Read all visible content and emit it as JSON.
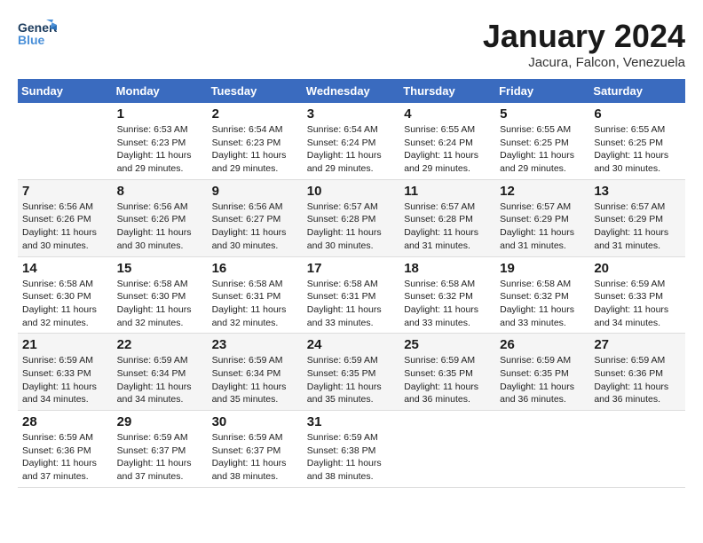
{
  "header": {
    "logo_general": "General",
    "logo_blue": "Blue",
    "month_year": "January 2024",
    "location": "Jacura, Falcon, Venezuela"
  },
  "days_of_week": [
    "Sunday",
    "Monday",
    "Tuesday",
    "Wednesday",
    "Thursday",
    "Friday",
    "Saturday"
  ],
  "weeks": [
    [
      {
        "num": "",
        "sunrise": "",
        "sunset": "",
        "daylight": ""
      },
      {
        "num": "1",
        "sunrise": "Sunrise: 6:53 AM",
        "sunset": "Sunset: 6:23 PM",
        "daylight": "Daylight: 11 hours and 29 minutes."
      },
      {
        "num": "2",
        "sunrise": "Sunrise: 6:54 AM",
        "sunset": "Sunset: 6:23 PM",
        "daylight": "Daylight: 11 hours and 29 minutes."
      },
      {
        "num": "3",
        "sunrise": "Sunrise: 6:54 AM",
        "sunset": "Sunset: 6:24 PM",
        "daylight": "Daylight: 11 hours and 29 minutes."
      },
      {
        "num": "4",
        "sunrise": "Sunrise: 6:55 AM",
        "sunset": "Sunset: 6:24 PM",
        "daylight": "Daylight: 11 hours and 29 minutes."
      },
      {
        "num": "5",
        "sunrise": "Sunrise: 6:55 AM",
        "sunset": "Sunset: 6:25 PM",
        "daylight": "Daylight: 11 hours and 29 minutes."
      },
      {
        "num": "6",
        "sunrise": "Sunrise: 6:55 AM",
        "sunset": "Sunset: 6:25 PM",
        "daylight": "Daylight: 11 hours and 30 minutes."
      }
    ],
    [
      {
        "num": "7",
        "sunrise": "Sunrise: 6:56 AM",
        "sunset": "Sunset: 6:26 PM",
        "daylight": "Daylight: 11 hours and 30 minutes."
      },
      {
        "num": "8",
        "sunrise": "Sunrise: 6:56 AM",
        "sunset": "Sunset: 6:26 PM",
        "daylight": "Daylight: 11 hours and 30 minutes."
      },
      {
        "num": "9",
        "sunrise": "Sunrise: 6:56 AM",
        "sunset": "Sunset: 6:27 PM",
        "daylight": "Daylight: 11 hours and 30 minutes."
      },
      {
        "num": "10",
        "sunrise": "Sunrise: 6:57 AM",
        "sunset": "Sunset: 6:28 PM",
        "daylight": "Daylight: 11 hours and 30 minutes."
      },
      {
        "num": "11",
        "sunrise": "Sunrise: 6:57 AM",
        "sunset": "Sunset: 6:28 PM",
        "daylight": "Daylight: 11 hours and 31 minutes."
      },
      {
        "num": "12",
        "sunrise": "Sunrise: 6:57 AM",
        "sunset": "Sunset: 6:29 PM",
        "daylight": "Daylight: 11 hours and 31 minutes."
      },
      {
        "num": "13",
        "sunrise": "Sunrise: 6:57 AM",
        "sunset": "Sunset: 6:29 PM",
        "daylight": "Daylight: 11 hours and 31 minutes."
      }
    ],
    [
      {
        "num": "14",
        "sunrise": "Sunrise: 6:58 AM",
        "sunset": "Sunset: 6:30 PM",
        "daylight": "Daylight: 11 hours and 32 minutes."
      },
      {
        "num": "15",
        "sunrise": "Sunrise: 6:58 AM",
        "sunset": "Sunset: 6:30 PM",
        "daylight": "Daylight: 11 hours and 32 minutes."
      },
      {
        "num": "16",
        "sunrise": "Sunrise: 6:58 AM",
        "sunset": "Sunset: 6:31 PM",
        "daylight": "Daylight: 11 hours and 32 minutes."
      },
      {
        "num": "17",
        "sunrise": "Sunrise: 6:58 AM",
        "sunset": "Sunset: 6:31 PM",
        "daylight": "Daylight: 11 hours and 33 minutes."
      },
      {
        "num": "18",
        "sunrise": "Sunrise: 6:58 AM",
        "sunset": "Sunset: 6:32 PM",
        "daylight": "Daylight: 11 hours and 33 minutes."
      },
      {
        "num": "19",
        "sunrise": "Sunrise: 6:58 AM",
        "sunset": "Sunset: 6:32 PM",
        "daylight": "Daylight: 11 hours and 33 minutes."
      },
      {
        "num": "20",
        "sunrise": "Sunrise: 6:59 AM",
        "sunset": "Sunset: 6:33 PM",
        "daylight": "Daylight: 11 hours and 34 minutes."
      }
    ],
    [
      {
        "num": "21",
        "sunrise": "Sunrise: 6:59 AM",
        "sunset": "Sunset: 6:33 PM",
        "daylight": "Daylight: 11 hours and 34 minutes."
      },
      {
        "num": "22",
        "sunrise": "Sunrise: 6:59 AM",
        "sunset": "Sunset: 6:34 PM",
        "daylight": "Daylight: 11 hours and 34 minutes."
      },
      {
        "num": "23",
        "sunrise": "Sunrise: 6:59 AM",
        "sunset": "Sunset: 6:34 PM",
        "daylight": "Daylight: 11 hours and 35 minutes."
      },
      {
        "num": "24",
        "sunrise": "Sunrise: 6:59 AM",
        "sunset": "Sunset: 6:35 PM",
        "daylight": "Daylight: 11 hours and 35 minutes."
      },
      {
        "num": "25",
        "sunrise": "Sunrise: 6:59 AM",
        "sunset": "Sunset: 6:35 PM",
        "daylight": "Daylight: 11 hours and 36 minutes."
      },
      {
        "num": "26",
        "sunrise": "Sunrise: 6:59 AM",
        "sunset": "Sunset: 6:35 PM",
        "daylight": "Daylight: 11 hours and 36 minutes."
      },
      {
        "num": "27",
        "sunrise": "Sunrise: 6:59 AM",
        "sunset": "Sunset: 6:36 PM",
        "daylight": "Daylight: 11 hours and 36 minutes."
      }
    ],
    [
      {
        "num": "28",
        "sunrise": "Sunrise: 6:59 AM",
        "sunset": "Sunset: 6:36 PM",
        "daylight": "Daylight: 11 hours and 37 minutes."
      },
      {
        "num": "29",
        "sunrise": "Sunrise: 6:59 AM",
        "sunset": "Sunset: 6:37 PM",
        "daylight": "Daylight: 11 hours and 37 minutes."
      },
      {
        "num": "30",
        "sunrise": "Sunrise: 6:59 AM",
        "sunset": "Sunset: 6:37 PM",
        "daylight": "Daylight: 11 hours and 38 minutes."
      },
      {
        "num": "31",
        "sunrise": "Sunrise: 6:59 AM",
        "sunset": "Sunset: 6:38 PM",
        "daylight": "Daylight: 11 hours and 38 minutes."
      },
      {
        "num": "",
        "sunrise": "",
        "sunset": "",
        "daylight": ""
      },
      {
        "num": "",
        "sunrise": "",
        "sunset": "",
        "daylight": ""
      },
      {
        "num": "",
        "sunrise": "",
        "sunset": "",
        "daylight": ""
      }
    ]
  ]
}
